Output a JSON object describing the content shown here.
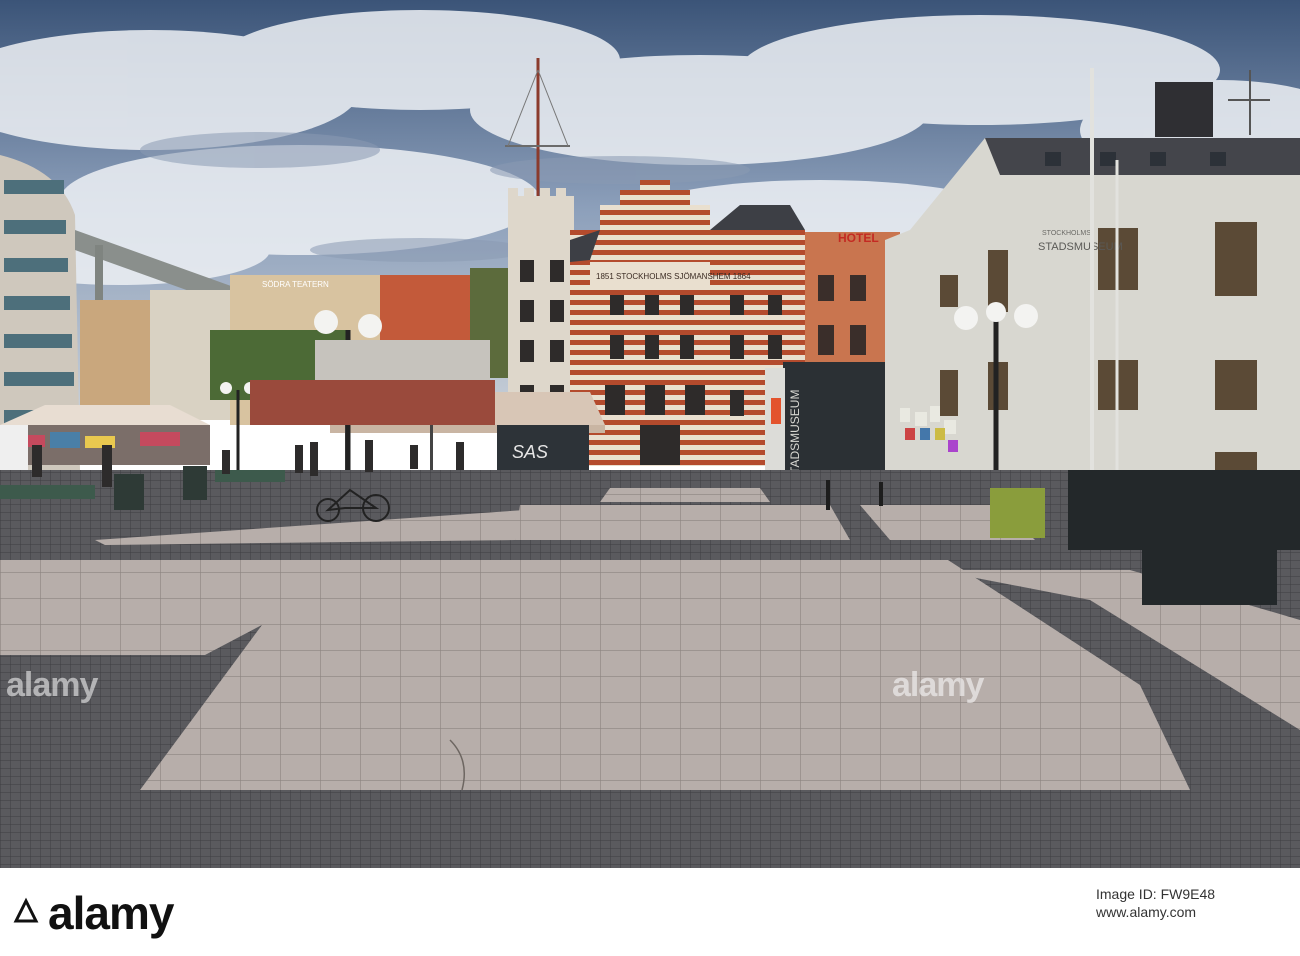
{
  "scene": {
    "facade_inscription": "1851 STOCKHOLMS SJÖMANSHEM 1864",
    "museum_sign_vertical": "STADSMUSEUM",
    "museum_wall_sign": "STADSMUSEUM",
    "museum_wall_sign_small": "STOCKHOLMS",
    "hotel_sign": "HOTEL",
    "theater_sign": "SÖDRA TEATERN",
    "kiosk_graffiti": "SAS"
  },
  "watermark": {
    "text": "alamy"
  },
  "footer": {
    "brand": "alamy",
    "image_id": "Image ID: FW9E48",
    "site": "www.alamy.com"
  },
  "colors": {
    "sky": "#6f86a8",
    "cloud": "#e8ecf2",
    "brick": "#b24a2e",
    "museum_wall": "#d9d9d2",
    "paving": "#b9b2ac",
    "cobble": "#555558"
  }
}
